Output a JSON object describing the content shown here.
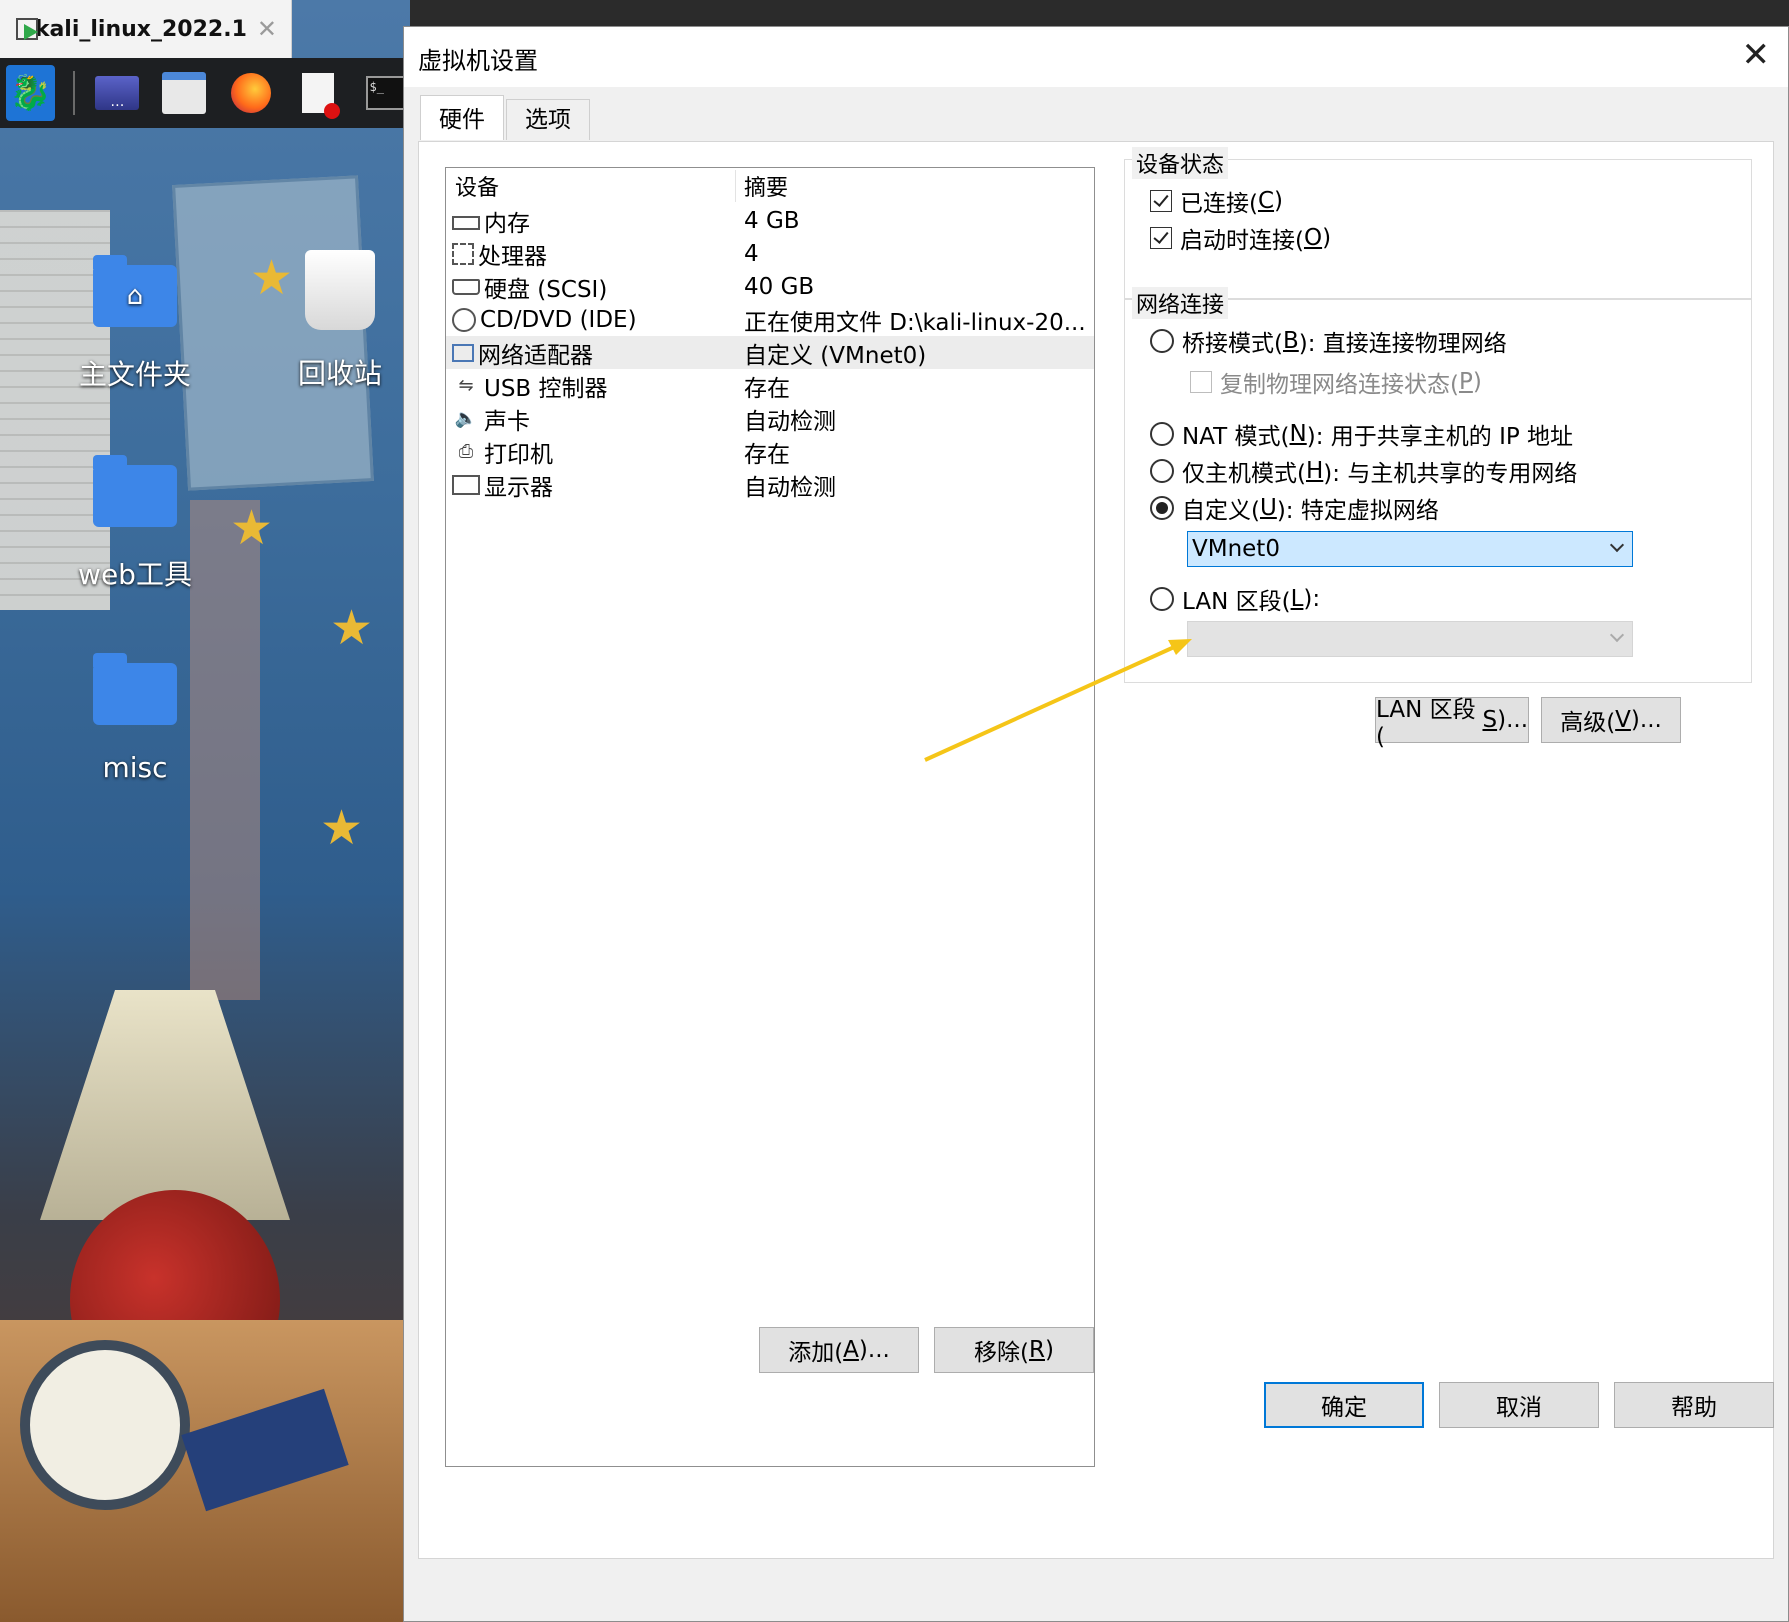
{
  "vm_tab": {
    "title": "kali_linux_2022.1",
    "close": "✕"
  },
  "desktop": {
    "icons": [
      {
        "label": "主文件夹"
      },
      {
        "label": "回收站"
      },
      {
        "label": "web工具"
      },
      {
        "label": "misc"
      }
    ]
  },
  "dialog": {
    "title": "虚拟机设置",
    "close": "✕",
    "tabs": [
      "硬件",
      "选项"
    ],
    "list": {
      "col_device": "设备",
      "col_summary": "摘要",
      "rows": [
        {
          "device": "内存",
          "summary": "4 GB",
          "icon": "memory-icon"
        },
        {
          "device": "处理器",
          "summary": "4",
          "icon": "cpu-icon"
        },
        {
          "device": "硬盘 (SCSI)",
          "summary": "40 GB",
          "icon": "disk-icon"
        },
        {
          "device": "CD/DVD (IDE)",
          "summary": "正在使用文件 D:\\kali-linux-20...",
          "icon": "cd-icon"
        },
        {
          "device": "网络适配器",
          "summary": "自定义 (VMnet0)",
          "icon": "network-icon"
        },
        {
          "device": "USB 控制器",
          "summary": "存在",
          "icon": "usb-icon"
        },
        {
          "device": "声卡",
          "summary": "自动检测",
          "icon": "speaker-icon"
        },
        {
          "device": "打印机",
          "summary": "存在",
          "icon": "printer-icon"
        },
        {
          "device": "显示器",
          "summary": "自动检测",
          "icon": "monitor-icon"
        }
      ]
    },
    "add_button": {
      "text": "添加(",
      "key": "A",
      "suffix": ")..."
    },
    "remove_button": {
      "text": "移除(",
      "key": "R",
      "suffix": ")"
    },
    "device_status": {
      "legend": "设备状态",
      "connected": {
        "text": "已连接(",
        "key": "C",
        "suffix": ")"
      },
      "connect_on_start": {
        "text": "启动时连接(",
        "key": "O",
        "suffix": ")"
      }
    },
    "network": {
      "legend": "网络连接",
      "bridged": {
        "text": "桥接模式(",
        "key": "B",
        "suffix": "): 直接连接物理网络"
      },
      "replicate": {
        "text": "复制物理网络连接状态(",
        "key": "P",
        "suffix": ")"
      },
      "nat": {
        "text": "NAT 模式(",
        "key": "N",
        "suffix": "): 用于共享主机的 IP 地址"
      },
      "hostonly": {
        "text": "仅主机模式(",
        "key": "H",
        "suffix": "): 与主机共享的专用网络"
      },
      "custom": {
        "text": "自定义(",
        "key": "U",
        "suffix": "): 特定虚拟网络"
      },
      "custom_value": "VMnet0",
      "lan": {
        "text": "LAN 区段(",
        "key": "L",
        "suffix": "):"
      },
      "lan_value": ""
    },
    "lan_segments_button": {
      "text": "LAN 区段(",
      "key": "S",
      "suffix": ")..."
    },
    "advanced_button": {
      "text": "高级(",
      "key": "V",
      "suffix": ")..."
    },
    "ok": "确定",
    "cancel": "取消",
    "help": "帮助"
  },
  "colors": {
    "accent": "#0078d7",
    "annotation_arrow": "#f5c518"
  }
}
